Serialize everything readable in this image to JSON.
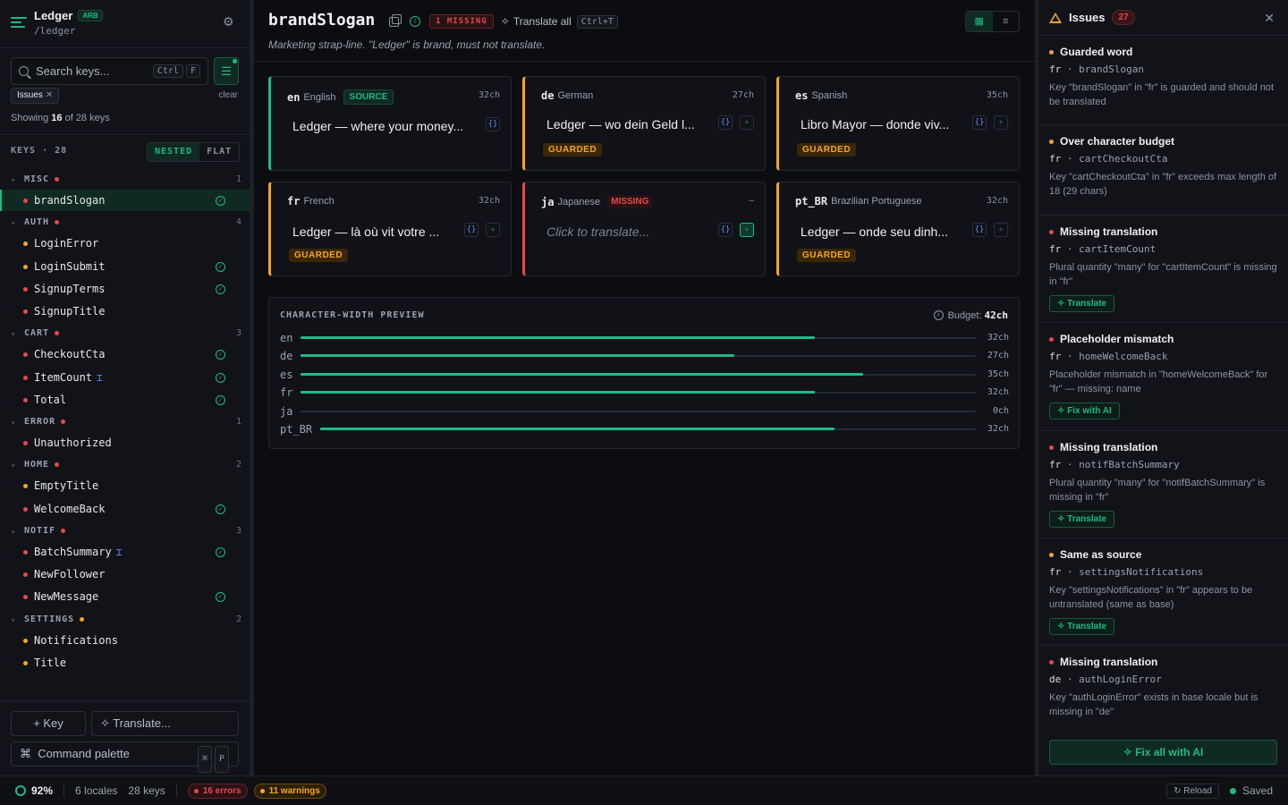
{
  "sidebar": {
    "app_name": "Ledger",
    "format_badge": "ARB",
    "path": "/ledger",
    "search_placeholder": "Search keys...",
    "search_shortcut": [
      "Ctrl",
      "F"
    ],
    "filter_chip": "Issues",
    "clear_label": "clear",
    "showing_prefix": "Showing",
    "showing_count": "16",
    "showing_suffix": "of 28 keys",
    "keys_label": "KEYS · 28",
    "view_modes": [
      "NESTED",
      "FLAT"
    ],
    "active_view_mode": "NESTED",
    "tree": [
      {
        "type": "group",
        "label": "MISC",
        "count": "1",
        "dot": "red"
      },
      {
        "type": "key",
        "label": "brandSlogan",
        "dot": "red",
        "ok": true,
        "selected": true
      },
      {
        "type": "group",
        "label": "AUTH",
        "count": "4",
        "dot": "red"
      },
      {
        "type": "key",
        "label": "LoginError",
        "dot": "amber"
      },
      {
        "type": "key",
        "label": "LoginSubmit",
        "dot": "amber",
        "ok": true
      },
      {
        "type": "key",
        "label": "SignupTerms",
        "dot": "red",
        "ok": true
      },
      {
        "type": "key",
        "label": "SignupTitle",
        "dot": "red"
      },
      {
        "type": "group",
        "label": "CART",
        "count": "3",
        "dot": "red"
      },
      {
        "type": "key",
        "label": "CheckoutCta",
        "dot": "red",
        "ok": true
      },
      {
        "type": "key",
        "label": "ItemCount",
        "dot": "red",
        "ok": true,
        "plural": true
      },
      {
        "type": "key",
        "label": "Total",
        "dot": "red",
        "ok": true
      },
      {
        "type": "group",
        "label": "ERROR",
        "count": "1",
        "dot": "red"
      },
      {
        "type": "key",
        "label": "Unauthorized",
        "dot": "red"
      },
      {
        "type": "group",
        "label": "HOME",
        "count": "2",
        "dot": "red"
      },
      {
        "type": "key",
        "label": "EmptyTitle",
        "dot": "amber"
      },
      {
        "type": "key",
        "label": "WelcomeBack",
        "dot": "red",
        "ok": true
      },
      {
        "type": "group",
        "label": "NOTIF",
        "count": "3",
        "dot": "red"
      },
      {
        "type": "key",
        "label": "BatchSummary",
        "dot": "red",
        "ok": true,
        "plural": true
      },
      {
        "type": "key",
        "label": "NewFollower",
        "dot": "red"
      },
      {
        "type": "key",
        "label": "NewMessage",
        "dot": "red",
        "ok": true
      },
      {
        "type": "group",
        "label": "SETTINGS",
        "count": "2",
        "dot": "amber"
      },
      {
        "type": "key",
        "label": "Notifications",
        "dot": "amber"
      },
      {
        "type": "key",
        "label": "Title",
        "dot": "amber"
      }
    ],
    "add_key_label": "+ Key",
    "translate_label": "Translate...",
    "command_palette_label": "Command palette",
    "command_shortcut": [
      "⌘",
      "P"
    ]
  },
  "main": {
    "key_name": "brandSlogan",
    "missing_badge": "1 MISSING",
    "translate_all_label": "Translate all",
    "translate_all_shortcut": "Ctrl+T",
    "description": "Marketing strap-line. \"Ledger\" is brand, must not translate.",
    "cards": [
      {
        "code": "en",
        "name": "English",
        "badge": "SOURCE",
        "width": "32ch",
        "text": "Ledger — where your money...",
        "status": "source",
        "ai": false
      },
      {
        "code": "de",
        "name": "German",
        "width": "27ch",
        "text": "Ledger — wo dein Geld l...",
        "status": "guarded",
        "guard": "GUARDED",
        "ai": true
      },
      {
        "code": "es",
        "name": "Spanish",
        "width": "35ch",
        "text": "Libro Mayor — donde viv...",
        "status": "guarded",
        "guard": "GUARDED",
        "ai": true
      },
      {
        "code": "fr",
        "name": "French",
        "width": "32ch",
        "text": "Ledger — là où vit votre ...",
        "status": "guarded",
        "guard": "GUARDED",
        "ai": true
      },
      {
        "code": "ja",
        "name": "Japanese",
        "badge": "MISSING",
        "width": "–",
        "text": "Click to translate...",
        "status": "missing",
        "ai": true
      },
      {
        "code": "pt_BR",
        "name": "Brazilian Portuguese",
        "width": "32ch",
        "text": "Ledger — onde seu dinh...",
        "status": "guarded",
        "guard": "GUARDED",
        "ai": true
      }
    ],
    "preview": {
      "title": "CHARACTER-WIDTH PREVIEW",
      "budget_label": "Budget:",
      "budget_value": "42ch",
      "budget": 42,
      "rows": [
        {
          "locale": "en",
          "chars": 32,
          "label": "32ch"
        },
        {
          "locale": "de",
          "chars": 27,
          "label": "27ch"
        },
        {
          "locale": "es",
          "chars": 35,
          "label": "35ch"
        },
        {
          "locale": "fr",
          "chars": 32,
          "label": "32ch"
        },
        {
          "locale": "ja",
          "chars": 0,
          "label": "0ch"
        },
        {
          "locale": "pt_BR",
          "chars": 32,
          "label": "32ch"
        }
      ]
    }
  },
  "issues": {
    "title": "Issues",
    "count": "27",
    "items": [
      {
        "title": "Guarded word",
        "dot": "amber",
        "locale": "fr",
        "key": "brandSlogan",
        "desc": "Key \"brandSlogan\" in \"fr\" is guarded and should not be translated"
      },
      {
        "title": "Over character budget",
        "dot": "amber",
        "locale": "fr",
        "key": "cartCheckoutCta",
        "desc": "Key \"cartCheckoutCta\" in \"fr\" exceeds max length of 18 (29 chars)"
      },
      {
        "title": "Missing translation",
        "dot": "red",
        "locale": "fr",
        "key": "cartItemCount",
        "desc": "Plural quantity \"many\" for \"cartItemCount\" is missing in \"fr\"",
        "action": "Translate"
      },
      {
        "title": "Placeholder mismatch",
        "dot": "red",
        "locale": "fr",
        "key": "homeWelcomeBack",
        "desc": "Placeholder mismatch in \"homeWelcomeBack\" for \"fr\" — missing: name",
        "action": "Fix with AI"
      },
      {
        "title": "Missing translation",
        "dot": "red",
        "locale": "fr",
        "key": "notifBatchSummary",
        "desc": "Plural quantity \"many\" for \"notifBatchSummary\" is missing in \"fr\"",
        "action": "Translate"
      },
      {
        "title": "Same as source",
        "dot": "amber",
        "locale": "fr",
        "key": "settingsNotifications",
        "desc": "Key \"settingsNotifications\" in \"fr\" appears to be untranslated (same as base)",
        "action": "Translate"
      },
      {
        "title": "Missing translation",
        "dot": "red",
        "locale": "de",
        "key": "authLoginError",
        "desc": "Key \"authLoginError\" exists in base locale but is missing in \"de\""
      }
    ],
    "fix_all_label": "Fix all with AI"
  },
  "status": {
    "coverage": "92%",
    "locales": "6 locales",
    "keys": "28 keys",
    "errors": "16 errors",
    "warnings": "11 warnings",
    "reload_label": "Reload",
    "saved_label": "Saved"
  },
  "colors": {
    "accent": "#1fb985",
    "error": "#e5484d",
    "warning": "#f5a524",
    "plural": "#5b8cff",
    "background": "#0b0d11"
  }
}
